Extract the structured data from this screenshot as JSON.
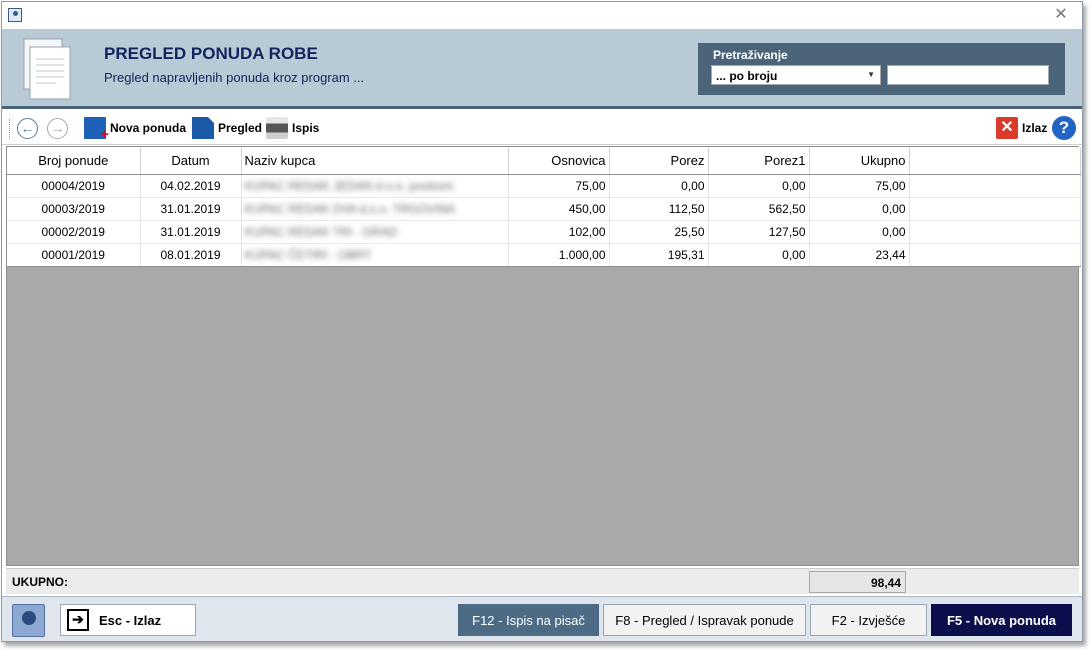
{
  "window": {
    "close_glyph": "✕"
  },
  "header": {
    "title": "PREGLED PONUDA ROBE",
    "subtitle": "Pregled napravljenih ponuda kroz program ..."
  },
  "search": {
    "label": "Pretraživanje",
    "mode": "... po broju",
    "value": "",
    "placeholder": ""
  },
  "toolbar": {
    "nova_ponuda": "Nova ponuda",
    "pregled": "Pregled",
    "ispis": "Ispis",
    "izlaz": "Izlaz",
    "help": "?"
  },
  "table": {
    "columns": [
      "Broj ponude",
      "Datum",
      "Naziv kupca",
      "Osnovica",
      "Porez",
      "Porez1",
      "Ukupno"
    ],
    "rows": [
      {
        "broj": "00004/2019",
        "datum": "04.02.2019",
        "kupac": "KUPAC REDAK JEDAN d.o.o. poslovni",
        "osnovica": "75,00",
        "porez": "0,00",
        "porez1": "0,00",
        "ukupno": "75,00"
      },
      {
        "broj": "00003/2019",
        "datum": "31.01.2019",
        "kupac": "KUPAC REDAK DVA d.o.o. TRGOVINA",
        "osnovica": "450,00",
        "porez": "112,50",
        "porez1": "562,50",
        "ukupno": "0,00"
      },
      {
        "broj": "00002/2019",
        "datum": "31.01.2019",
        "kupac": "KUPAC REDAK TRI - GRAD",
        "osnovica": "102,00",
        "porez": "25,50",
        "porez1": "127,50",
        "ukupno": "0,00"
      },
      {
        "broj": "00001/2019",
        "datum": "08.01.2019",
        "kupac": "KUPAC ČETIRI - OBRT",
        "osnovica": "1.000,00",
        "porez": "195,31",
        "porez1": "0,00",
        "ukupno": "23,44"
      }
    ]
  },
  "totals": {
    "label": "UKUPNO:",
    "value": "98,44"
  },
  "footer": {
    "esc": "Esc - Izlaz",
    "f12": "F12 - Ispis na pisač",
    "f8": "F8 - Pregled / Ispravak ponude",
    "f2": "F2 - Izvješće",
    "f5": "F5 - Nova ponuda"
  },
  "colors": {
    "header_bg": "#b7cad6",
    "title": "#13235e",
    "search_panel": "#4c6479",
    "primary_button": "#0d0f4c",
    "slate_button": "#4d6b84"
  }
}
